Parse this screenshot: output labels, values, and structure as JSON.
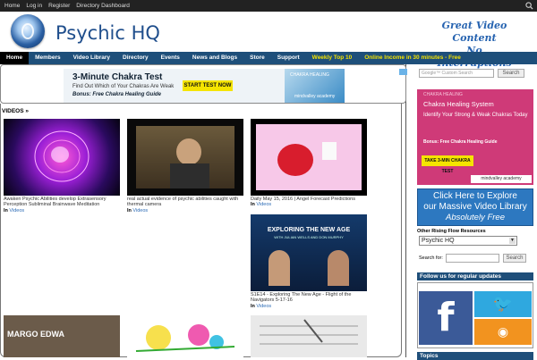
{
  "topbar": {
    "links": [
      "Home",
      "Log in",
      "Register",
      "Directory Dashboard"
    ]
  },
  "header": {
    "site_title": "Psychic HQ",
    "tagline_line1": "Great Video Content",
    "tagline_line2": "No Interruptions"
  },
  "nav": {
    "items": [
      "Home",
      "Members",
      "Video Library",
      "Directory",
      "Events",
      "News and Blogs",
      "Store",
      "Support",
      "Weekly Top 10",
      "Online Income in 30 minutes - Free"
    ]
  },
  "top_ad": {
    "title": "3-Minute Chakra Test",
    "subtitle": "Find Out Which of Your Chakras Are Weak",
    "bonus": "Bonus: Free Chakra Healing Guide",
    "button": "START TEST NOW",
    "brand": "mindvalley academy",
    "brand_small": "CHAKRA HEALING"
  },
  "videos": {
    "heading": "VIDEOS »",
    "in_label": "In",
    "items": [
      {
        "title": "Awaken Psychic Abilities develop Extrasensory Perception Subliminal Brainwave Meditation",
        "category": "Videos"
      },
      {
        "title": "real actual evidence of psychic abilities caught with thermal camera",
        "category": "Videos"
      },
      {
        "title": "Daily May 15, 2016 | Angel Forecast Predictions",
        "category": "Videos"
      },
      {
        "title": "S1E14 - Exploring The New Age - Flight of the Navigators 5-17-16",
        "category": "Videos",
        "thumb_title": "EXPLORING THE NEW AGE",
        "thumb_sub": "WITH JULIAN WELLS AND DON MURPHY"
      },
      {
        "title": "",
        "category": "",
        "thumb_text": "MARGO EDWA"
      },
      {
        "title": "",
        "category": ""
      },
      {
        "title": "",
        "category": ""
      }
    ]
  },
  "sidebar": {
    "search_placeholder": "Google™ Custom Search",
    "search_button": "Search",
    "ad1": {
      "brand_small": "CHAKRA HEALING",
      "title": "Chakra Healing System",
      "subtitle": "Identify Your Strong & Weak Chakras Today",
      "bonus": "Bonus: Free Chakra Healing Guide",
      "button": "TAKE 3-MIN CHAKRA TEST",
      "brand": "mindvalley academy"
    },
    "ad2": {
      "line1": "Click Here to Explore",
      "line2": "our Massive Video Library",
      "line3": "Absolutely Free"
    },
    "other_label": "Other Rising Flow Resources",
    "select_value": "Psychic HQ",
    "search_for_label": "Search for:",
    "search_button2": "Search",
    "follow_label": "Follow us for regular updates",
    "topics_label": "Topics"
  }
}
